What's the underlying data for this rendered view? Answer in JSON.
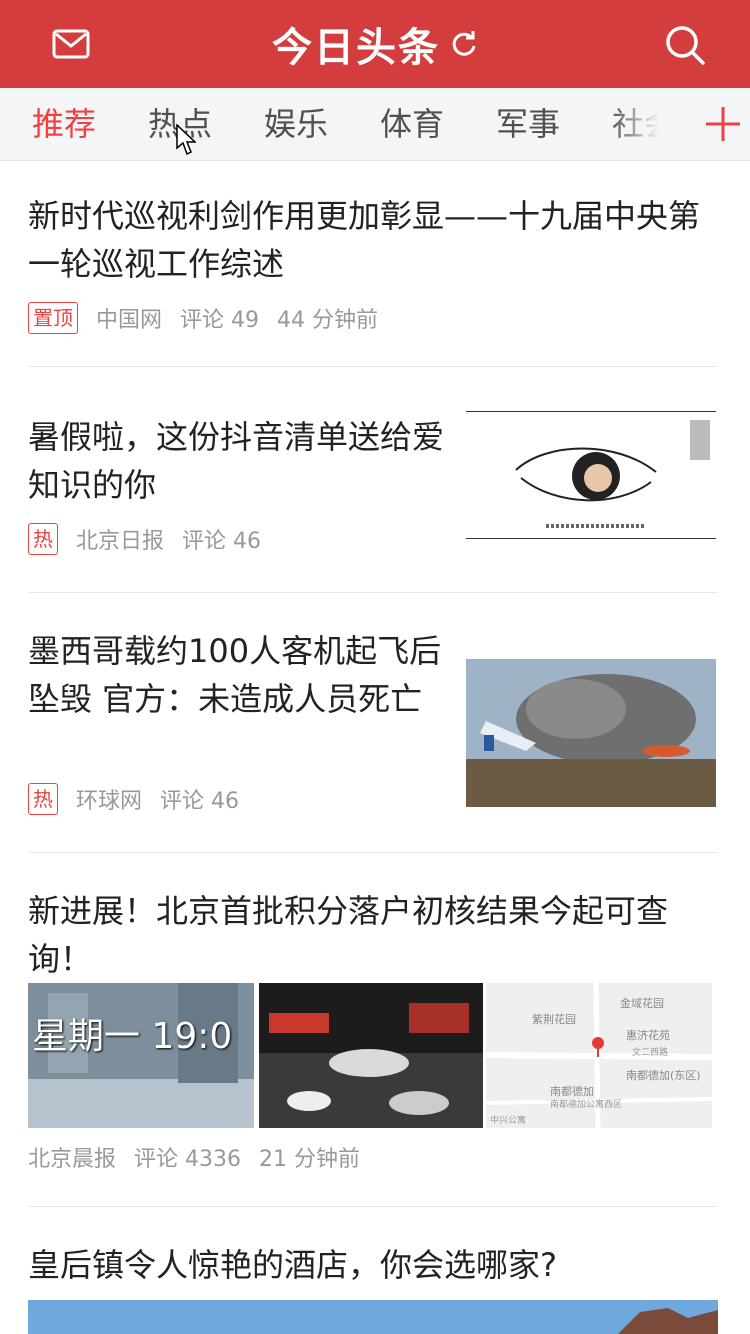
{
  "app": {
    "title": "今日头条"
  },
  "colors": {
    "brand_red": "#d43d3d",
    "accent_red": "#f04142",
    "tab_bg": "#f4f5f6"
  },
  "icons": {
    "mail": "mail-icon",
    "search": "search-icon",
    "refresh": "refresh-icon",
    "add_channel": "plus-icon"
  },
  "tabs": [
    {
      "label": "推荐",
      "active": true
    },
    {
      "label": "热点",
      "active": false
    },
    {
      "label": "娱乐",
      "active": false
    },
    {
      "label": "体育",
      "active": false
    },
    {
      "label": "军事",
      "active": false
    },
    {
      "label": "社会",
      "active": false
    }
  ],
  "feed": [
    {
      "title": "新时代巡视利剑作用更加彰显——十九届中央第一轮巡视工作综述",
      "badge": "置顶",
      "source": "中国网",
      "comments": "评论 49",
      "time": "44 分钟前"
    },
    {
      "title": "暑假啦，这份抖音清单送给爱知识的你",
      "badge": "热",
      "source": "北京日报",
      "comments": "评论 46",
      "time": ""
    },
    {
      "title": "墨西哥载约100人客机起飞后坠毁 官方：未造成人员死亡",
      "badge": "热",
      "source": "环球网",
      "comments": "评论 46",
      "time": ""
    },
    {
      "title": "新进展！北京首批积分落户初核结果今起可查询！",
      "badge": "",
      "source": "北京晨报",
      "comments": "评论 4336",
      "time": "21 分钟前",
      "image_texts": {
        "video_caption": "星期一  19:0",
        "map_labels": [
          "金域花园",
          "紫荆花园",
          "惠济花苑",
          "南都德加",
          "南都德加(东区)",
          "文二西路",
          "南都德加公寓西区",
          "中兴公寓"
        ]
      }
    },
    {
      "title": "皇后镇令人惊艳的酒店，你会选哪家?",
      "badge": "",
      "source": "",
      "comments": "",
      "time": ""
    }
  ]
}
